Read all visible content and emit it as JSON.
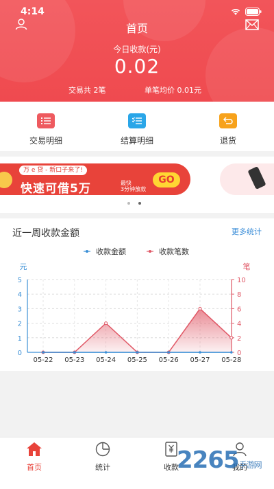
{
  "status_bar": {
    "time": "4:14"
  },
  "header": {
    "title": "首页",
    "today_label": "今日收款(元)",
    "amount": "0.02",
    "trade_count": "交易共 2笔",
    "avg_price": "单笔均价 0.01元"
  },
  "quick_actions": [
    {
      "label": "交易明细",
      "icon": "list-icon",
      "color": "#ee5a5f"
    },
    {
      "label": "结算明细",
      "icon": "checklist-icon",
      "color": "#2aa6e8"
    },
    {
      "label": "退货",
      "icon": "return-icon",
      "color": "#f7a21b"
    }
  ],
  "banner": {
    "tag": "万 e 贷 - 新口子来了!",
    "headline": "快速可借5万",
    "note1": "最快",
    "note2": "3分钟放款",
    "go": "GO"
  },
  "chart_section": {
    "title": "近一周收款金额",
    "more": "更多统计"
  },
  "chart_data": {
    "type": "line",
    "categories": [
      "05-22",
      "05-23",
      "05-24",
      "05-25",
      "05-26",
      "05-27",
      "05-28"
    ],
    "series": [
      {
        "name": "收款金额",
        "axis": "left",
        "values": [
          0,
          0,
          0,
          0,
          0,
          0,
          0
        ],
        "color": "#3a8fd6"
      },
      {
        "name": "收款笔数",
        "axis": "right",
        "values": [
          0,
          0,
          4,
          0,
          0,
          6,
          2
        ],
        "color": "#e05866"
      }
    ],
    "ylabel_left": "元",
    "ylabel_right": "笔",
    "ylim_left": [
      0,
      5
    ],
    "yticks_left": [
      "0",
      "1",
      "2",
      "3",
      "4",
      "5"
    ],
    "ylim_right": [
      0,
      10
    ],
    "yticks_right": [
      "0",
      "2",
      "4",
      "6",
      "8",
      "10"
    ],
    "legend_position": "top-center",
    "grid": true
  },
  "tabbar": [
    {
      "label": "首页",
      "icon": "home-icon",
      "active": true
    },
    {
      "label": "统计",
      "icon": "pie-chart-icon"
    },
    {
      "label": "收款",
      "icon": "yuan-receipt-icon"
    },
    {
      "label": "我的",
      "icon": "user-icon"
    }
  ],
  "watermark": {
    "main": "2265",
    "sub": "手游网"
  }
}
